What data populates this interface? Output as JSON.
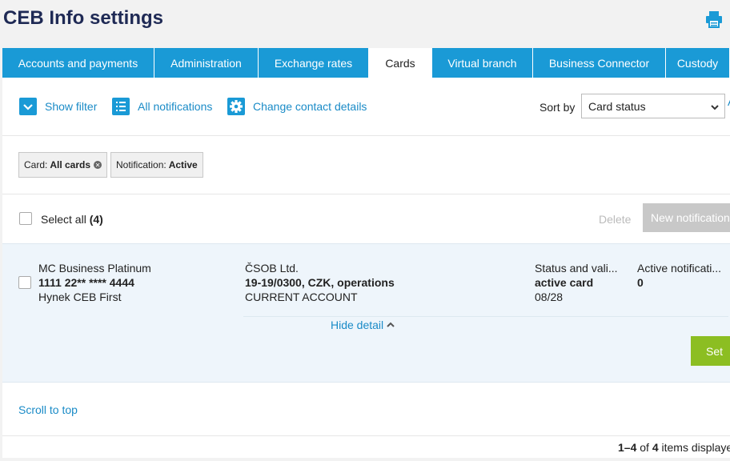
{
  "header": {
    "title": "CEB Info settings"
  },
  "tabs": [
    {
      "label": "Accounts and payments",
      "active": false
    },
    {
      "label": "Administration",
      "active": false
    },
    {
      "label": "Exchange rates",
      "active": false
    },
    {
      "label": "Cards",
      "active": true
    },
    {
      "label": "Virtual branch",
      "active": false
    },
    {
      "label": "Business Connector",
      "active": false
    },
    {
      "label": "Custody",
      "active": false
    }
  ],
  "toolbar": {
    "show_filter": "Show filter",
    "all_notifications": "All notifications",
    "change_contact": "Change contact details",
    "sort_label": "Sort by",
    "sort_value": "Card status",
    "sort_extra": "A"
  },
  "filters": [
    {
      "key": "Card:",
      "value": "All cards",
      "removable": true
    },
    {
      "key": "Notification:",
      "value": "Active",
      "removable": false
    }
  ],
  "selection": {
    "select_all": "Select all",
    "count": "(4)",
    "delete_label": "Delete",
    "new_label": "New notification"
  },
  "card": {
    "name": "MC Business Platinum",
    "number": "1111 22** **** 4444",
    "holder": "Hynek CEB First",
    "company": "ČSOB Ltd.",
    "account": "19-19/0300, CZK, operations",
    "account_type": "CURRENT ACCOUNT",
    "status_label": "Status and vali...",
    "status": "active card",
    "valid": "08/28",
    "notif_label": "Active notificati...",
    "notif_count": "0",
    "hide_detail": "Hide detail",
    "set_label": "Set"
  },
  "footer": {
    "scroll_top": "Scroll to top",
    "range": "1–4",
    "of": "of",
    "total": "4",
    "suffix": "items displayed"
  },
  "colors": {
    "accent": "#1a9ad6",
    "link": "#1a8bc7",
    "title": "#1f2a55",
    "set_button": "#8cbe22",
    "row_bg": "#eef5fb"
  }
}
